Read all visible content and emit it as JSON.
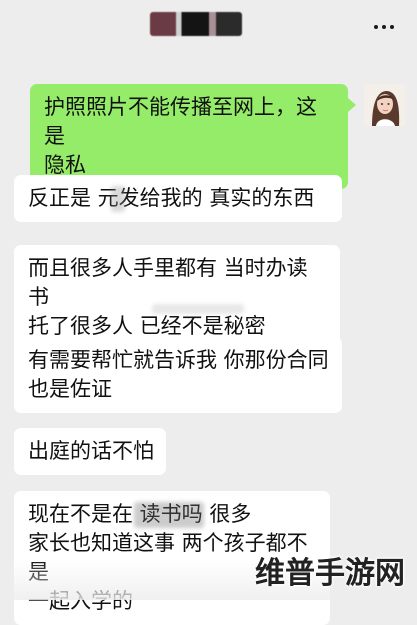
{
  "header": {
    "title_obscured": true,
    "back_icon": "chevron-left-icon",
    "more_icon": "more-dots-icon"
  },
  "colors": {
    "background": "#ededed",
    "outgoing_bubble": "#95ec69",
    "incoming_bubble": "#ffffff"
  },
  "messages": [
    {
      "direction": "out",
      "text": "护照照片不能传播至网上，这是\n隐私"
    },
    {
      "direction": "in",
      "text": "反正是   元发给我的 真实的东西"
    },
    {
      "direction": "in",
      "text": "而且很多人手里都有 当时办读书\n托了很多人 已经不是秘密"
    },
    {
      "direction": "in",
      "text": "有需要帮忙就告诉我 你那份合同\n也是佐证"
    },
    {
      "direction": "in",
      "text": "出庭的话不怕"
    },
    {
      "direction": "in",
      "text": "现在不是在       读书吗 很多\n家长也知道这事 两个孩子都不是\n一起入学的"
    }
  ],
  "watermark": "维普手游网"
}
